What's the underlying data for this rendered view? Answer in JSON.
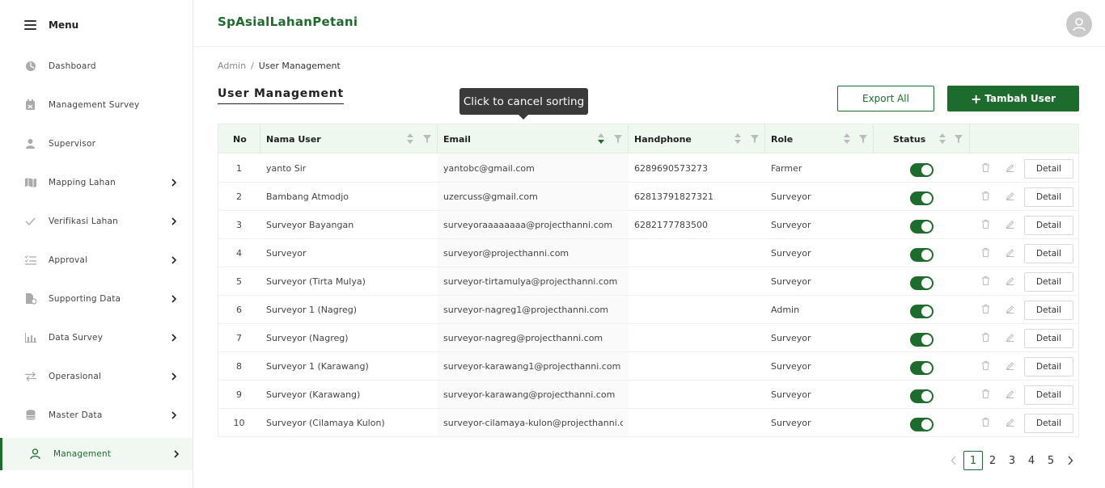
{
  "sidebar": {
    "menu_label": "Menu",
    "items": [
      {
        "label": "Dashboard",
        "icon": "dashboard-icon",
        "chevron": false
      },
      {
        "label": "Management Survey",
        "icon": "calendar-icon",
        "chevron": false
      },
      {
        "label": "Supervisor",
        "icon": "user-icon",
        "chevron": false
      },
      {
        "label": "Mapping Lahan",
        "icon": "map-icon",
        "chevron": true
      },
      {
        "label": "Verifikasi Lahan",
        "icon": "check-icon",
        "chevron": true
      },
      {
        "label": "Approval",
        "icon": "list-check-icon",
        "chevron": true
      },
      {
        "label": "Supporting Data",
        "icon": "file-gear-icon",
        "chevron": true
      },
      {
        "label": "Data Survey",
        "icon": "bar-chart-icon",
        "chevron": true
      },
      {
        "label": "Operasional",
        "icon": "swap-icon",
        "chevron": true
      },
      {
        "label": "Master Data",
        "icon": "database-icon",
        "chevron": true
      },
      {
        "label": "Management",
        "icon": "user-outline-icon",
        "chevron": true,
        "active": true
      }
    ]
  },
  "header": {
    "brand": "SpAsialLahanPetani"
  },
  "breadcrumb": {
    "root": "Admin",
    "separator": "/",
    "current": "User Management"
  },
  "page": {
    "title": "User Management",
    "export_label": "Export All",
    "add_label": "Tambah User",
    "tooltip": "Click to cancel sorting"
  },
  "table": {
    "columns": [
      "No",
      "Nama User",
      "Email",
      "Handphone",
      "Role",
      "Status"
    ],
    "detail_label": "Detail",
    "rows": [
      {
        "no": "1",
        "name": "yanto Sir",
        "email": "yantobc@gmail.com",
        "phone": "6289690573273",
        "role": "Farmer",
        "status": true
      },
      {
        "no": "2",
        "name": "Bambang Atmodjo",
        "email": "uzercuss@gmail.com",
        "phone": "62813791827321",
        "role": "Surveyor",
        "status": true
      },
      {
        "no": "3",
        "name": "Surveyor Bayangan",
        "email": "surveyoraaaaaaaa@projecthanni.com",
        "phone": "6282177783500",
        "role": "Surveyor",
        "status": true
      },
      {
        "no": "4",
        "name": "Surveyor",
        "email": "surveyor@projecthanni.com",
        "phone": "",
        "role": "Surveyor",
        "status": true
      },
      {
        "no": "5",
        "name": "Surveyor (Tirta Mulya)",
        "email": "surveyor-tirtamulya@projecthanni.com",
        "phone": "",
        "role": "Surveyor",
        "status": true
      },
      {
        "no": "6",
        "name": "Surveyor 1 (Nagreg)",
        "email": "surveyor-nagreg1@projecthanni.com",
        "phone": "",
        "role": "Admin",
        "status": true
      },
      {
        "no": "7",
        "name": "Surveyor (Nagreg)",
        "email": "surveyor-nagreg@projecthanni.com",
        "phone": "",
        "role": "Surveyor",
        "status": true
      },
      {
        "no": "8",
        "name": "Surveyor 1 (Karawang)",
        "email": "surveyor-karawang1@projecthanni.com",
        "phone": "",
        "role": "Surveyor",
        "status": true
      },
      {
        "no": "9",
        "name": "Surveyor (Karawang)",
        "email": "surveyor-karawang@projecthanni.com",
        "phone": "",
        "role": "Surveyor",
        "status": true
      },
      {
        "no": "10",
        "name": "Surveyor (Cilamaya Kulon)",
        "email": "surveyor-cilamaya-kulon@projecthanni.c...",
        "phone": "",
        "role": "Surveyor",
        "status": true
      }
    ]
  },
  "pagination": {
    "pages": [
      "1",
      "2",
      "3",
      "4",
      "5"
    ],
    "current": "1"
  },
  "colors": {
    "primary": "#1e6b2e",
    "header_bg": "#eef8ef"
  }
}
